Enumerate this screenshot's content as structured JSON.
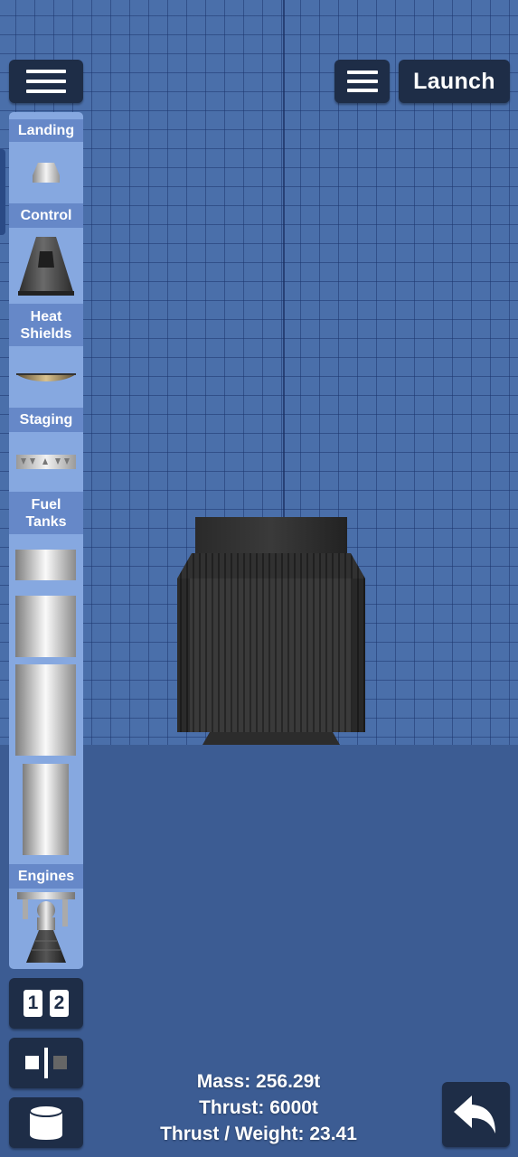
{
  "toolbar": {
    "menu_icon": "hamburger-icon",
    "launch_label": "Launch"
  },
  "parts_panel": {
    "categories": [
      {
        "label": "Landing",
        "parts": [
          "landing-leg"
        ]
      },
      {
        "label": "Control",
        "parts": [
          "command-pod"
        ]
      },
      {
        "label": "Heat\nShields",
        "parts": [
          "heat-shield"
        ]
      },
      {
        "label": "Staging",
        "parts": [
          "separator-ring"
        ]
      },
      {
        "label": "Fuel\nTanks",
        "parts": [
          "fuel-tank-small",
          "fuel-tank-medium",
          "fuel-tank-large",
          "fuel-tank-narrow"
        ]
      },
      {
        "label": "Engines",
        "parts": [
          "rocket-engine"
        ]
      }
    ]
  },
  "bottom_left": {
    "stage_numbers": [
      "1",
      "2"
    ],
    "symmetry_icon": "symmetry-icon",
    "parts_icon": "fuel-tank-icon"
  },
  "stats": {
    "mass": "Mass: 256.29t",
    "thrust": "Thrust: 6000t",
    "thrust_weight": "Thrust / Weight: 23.41"
  },
  "undo_icon": "undo-arrow-icon",
  "colors": {
    "grid_bg": "#4a6faa",
    "ground": "#3c5c93",
    "button_bg": "#1e2d47",
    "panel_bg": "#86a8e0",
    "panel_header": "#6688c8"
  }
}
